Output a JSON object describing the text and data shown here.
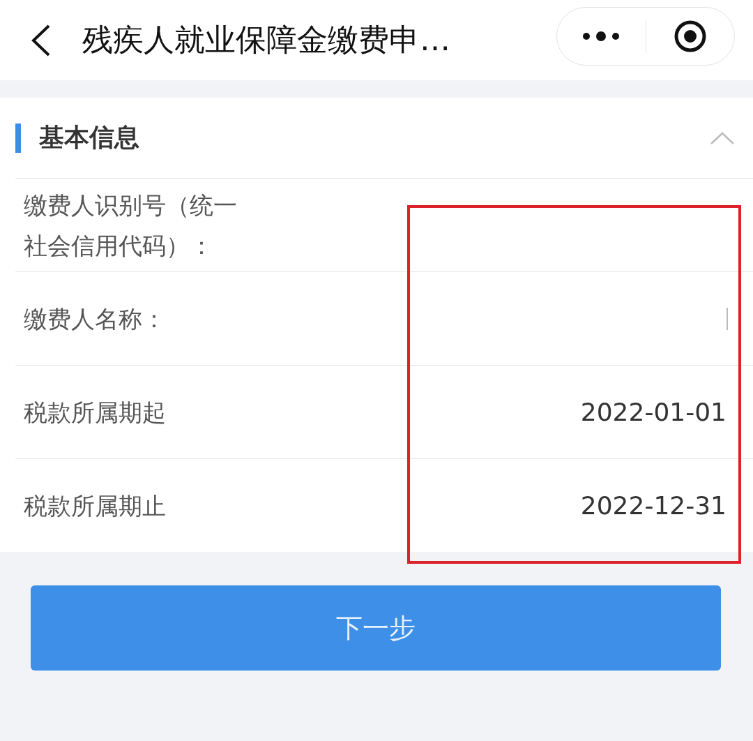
{
  "nav_bar": {
    "title": "残疾人就业保障金缴费申…"
  },
  "section": {
    "title": "基本信息",
    "expanded": true,
    "fields": [
      {
        "label": "缴费人识别号（统一社会信用代码）：",
        "focused": false
      },
      {
        "label": "缴费人名称：",
        "focused": true
      },
      {
        "label": "税款所属期起",
        "value": "2022-01-01",
        "focused": false
      },
      {
        "label": "税款所属期止",
        "value": "2022-12-31",
        "focused": false
      }
    ]
  },
  "next_button": {
    "label": "下一步"
  }
}
